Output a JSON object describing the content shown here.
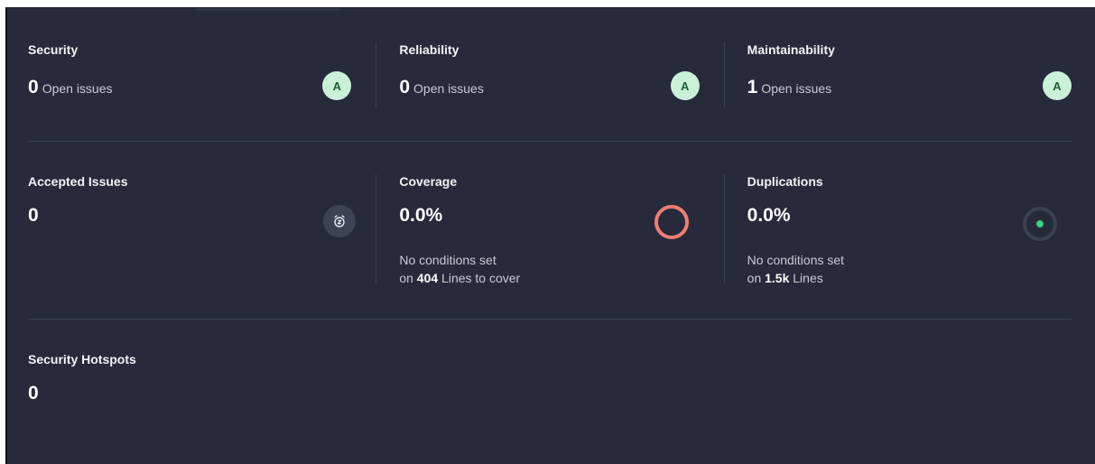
{
  "rows": {
    "issues": {
      "security": {
        "title": "Security",
        "value": "0",
        "unit": "Open issues",
        "grade": "A"
      },
      "reliability": {
        "title": "Reliability",
        "value": "0",
        "unit": "Open issues",
        "grade": "A"
      },
      "maintainability": {
        "title": "Maintainability",
        "value": "1",
        "unit": "Open issues",
        "grade": "A"
      }
    },
    "metrics": {
      "accepted": {
        "title": "Accepted Issues",
        "value": "0",
        "icon": "snooze-clock-icon"
      },
      "coverage": {
        "title": "Coverage",
        "value": "0.0%",
        "line1": "No conditions set",
        "line2_prefix": "on",
        "line2_count": "404",
        "line2_suffix": "Lines to cover",
        "ring_color": "#ef7d74",
        "percent": 0.0
      },
      "duplications": {
        "title": "Duplications",
        "value": "0.0%",
        "line1": "No conditions set",
        "line2_prefix": "on",
        "line2_count": "1.5k",
        "line2_suffix": "Lines",
        "dot_color": "#3ad27a",
        "percent": 0.0
      }
    },
    "hotspots": {
      "title": "Security Hotspots",
      "value": "0"
    }
  },
  "colors": {
    "background": "#262a3a",
    "grade_bg": "#c9f1d8",
    "grade_text": "#1f5c36"
  }
}
